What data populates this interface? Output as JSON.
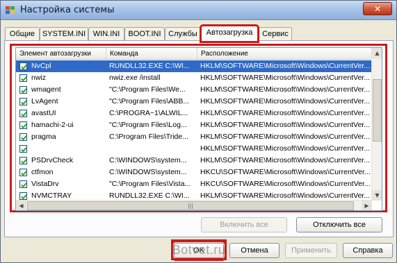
{
  "window": {
    "title": "Настройка системы",
    "close_glyph": "✕"
  },
  "tabs": [
    {
      "label": "Общие",
      "active": false
    },
    {
      "label": "SYSTEM.INI",
      "active": false
    },
    {
      "label": "WIN.INI",
      "active": false
    },
    {
      "label": "BOOT.INI",
      "active": false
    },
    {
      "label": "Службы",
      "active": false
    },
    {
      "label": "Автозагрузка",
      "active": true
    },
    {
      "label": "Сервис",
      "active": false
    }
  ],
  "list": {
    "columns": [
      "Элемент автозагрузки",
      "Команда",
      "Расположение"
    ],
    "rows": [
      {
        "checked": true,
        "selected": true,
        "item": "NvCpl",
        "command": "RUNDLL32.EXE C:\\WI...",
        "location": "HKLM\\SOFTWARE\\Microsoft\\Windows\\CurrentVer..."
      },
      {
        "checked": true,
        "selected": false,
        "item": "nwiz",
        "command": "nwiz.exe /install",
        "location": "HKLM\\SOFTWARE\\Microsoft\\Windows\\CurrentVer..."
      },
      {
        "checked": true,
        "selected": false,
        "item": "wmagent",
        "command": "\"C:\\Program Files\\We...",
        "location": "HKLM\\SOFTWARE\\Microsoft\\Windows\\CurrentVer..."
      },
      {
        "checked": true,
        "selected": false,
        "item": "LvAgent",
        "command": "\"C:\\Program Files\\ABB...",
        "location": "HKLM\\SOFTWARE\\Microsoft\\Windows\\CurrentVer..."
      },
      {
        "checked": true,
        "selected": false,
        "item": "avastUI",
        "command": "C:\\PROGRA~1\\ALWIL...",
        "location": "HKLM\\SOFTWARE\\Microsoft\\Windows\\CurrentVer..."
      },
      {
        "checked": true,
        "selected": false,
        "item": "hamachi-2-ui",
        "command": "\"C:\\Program Files\\Log...",
        "location": "HKLM\\SOFTWARE\\Microsoft\\Windows\\CurrentVer..."
      },
      {
        "checked": true,
        "selected": false,
        "item": "pragma",
        "command": "C:\\Program Files\\Tride...",
        "location": "HKLM\\SOFTWARE\\Microsoft\\Windows\\CurrentVer..."
      },
      {
        "checked": true,
        "selected": false,
        "item": "",
        "command": "",
        "location": "HKLM\\SOFTWARE\\Microsoft\\Windows\\CurrentVer..."
      },
      {
        "checked": true,
        "selected": false,
        "item": "PSDrvCheck",
        "command": "C:\\WINDOWS\\system...",
        "location": "HKLM\\SOFTWARE\\Microsoft\\Windows\\CurrentVer..."
      },
      {
        "checked": true,
        "selected": false,
        "item": "ctfmon",
        "command": "C:\\WINDOWS\\system...",
        "location": "HKCU\\SOFTWARE\\Microsoft\\Windows\\CurrentVer..."
      },
      {
        "checked": true,
        "selected": false,
        "item": "VistaDrv",
        "command": "\"C:\\Program Files\\Vista...",
        "location": "HKCU\\SOFTWARE\\Microsoft\\Windows\\CurrentVer..."
      },
      {
        "checked": true,
        "selected": false,
        "item": "NVMCTRAY",
        "command": "RUNDLL32.EXE C:\\WI...",
        "location": "HKLM\\SOFTWARE\\Microsoft\\Windows\\CurrentVer..."
      }
    ],
    "hscroll_grip": "|||"
  },
  "buttons": {
    "enable_all": "Включить все",
    "disable_all": "Отключить все",
    "ok": "OK",
    "cancel": "Отмена",
    "apply": "Применить",
    "help": "Справка"
  },
  "watermark": "Botvet.ru",
  "colors": {
    "highlight_red": "#cc1a1a",
    "selection_blue": "#3169c6"
  }
}
